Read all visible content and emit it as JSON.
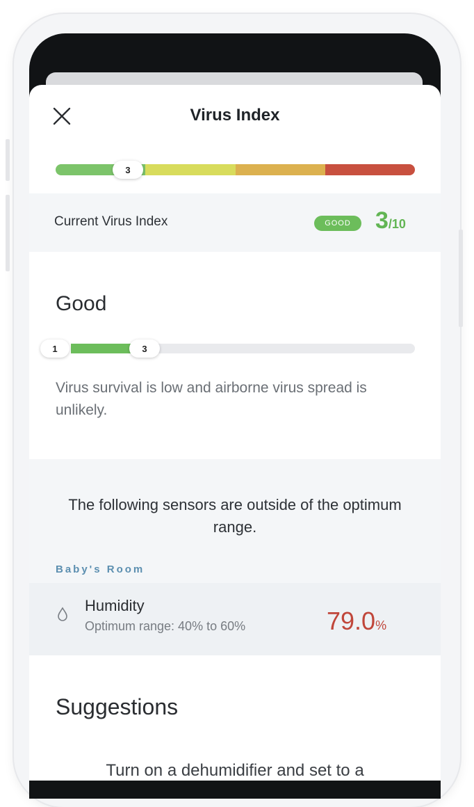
{
  "header": {
    "title": "Virus Index",
    "close_icon": "close-icon"
  },
  "index_scale": {
    "current_value": "3",
    "segments": [
      {
        "color": "#7cc46a"
      },
      {
        "color": "#d8dc5c"
      },
      {
        "color": "#dcb14f"
      },
      {
        "color": "#c8503f"
      }
    ]
  },
  "current_index": {
    "label": "Current Virus Index",
    "status": "GOOD",
    "value": "3",
    "denominator": "/10",
    "color": "#62b554"
  },
  "level": {
    "title": "Good",
    "min": "1",
    "value": "3",
    "description": "Virus survival is low and airborne virus spread is unlikely."
  },
  "sensors": {
    "notice": "The following sensors are outside of the optimum range.",
    "room": "Baby's Room",
    "items": [
      {
        "icon": "water-drop-icon",
        "name": "Humidity",
        "range": "Optimum range: 40% to 60%",
        "value": "79.0",
        "unit": "%",
        "color": "#c0463a"
      }
    ]
  },
  "suggestions": {
    "title": "Suggestions",
    "first_line_partial": "Turn on a dehumidifier and set to a"
  }
}
